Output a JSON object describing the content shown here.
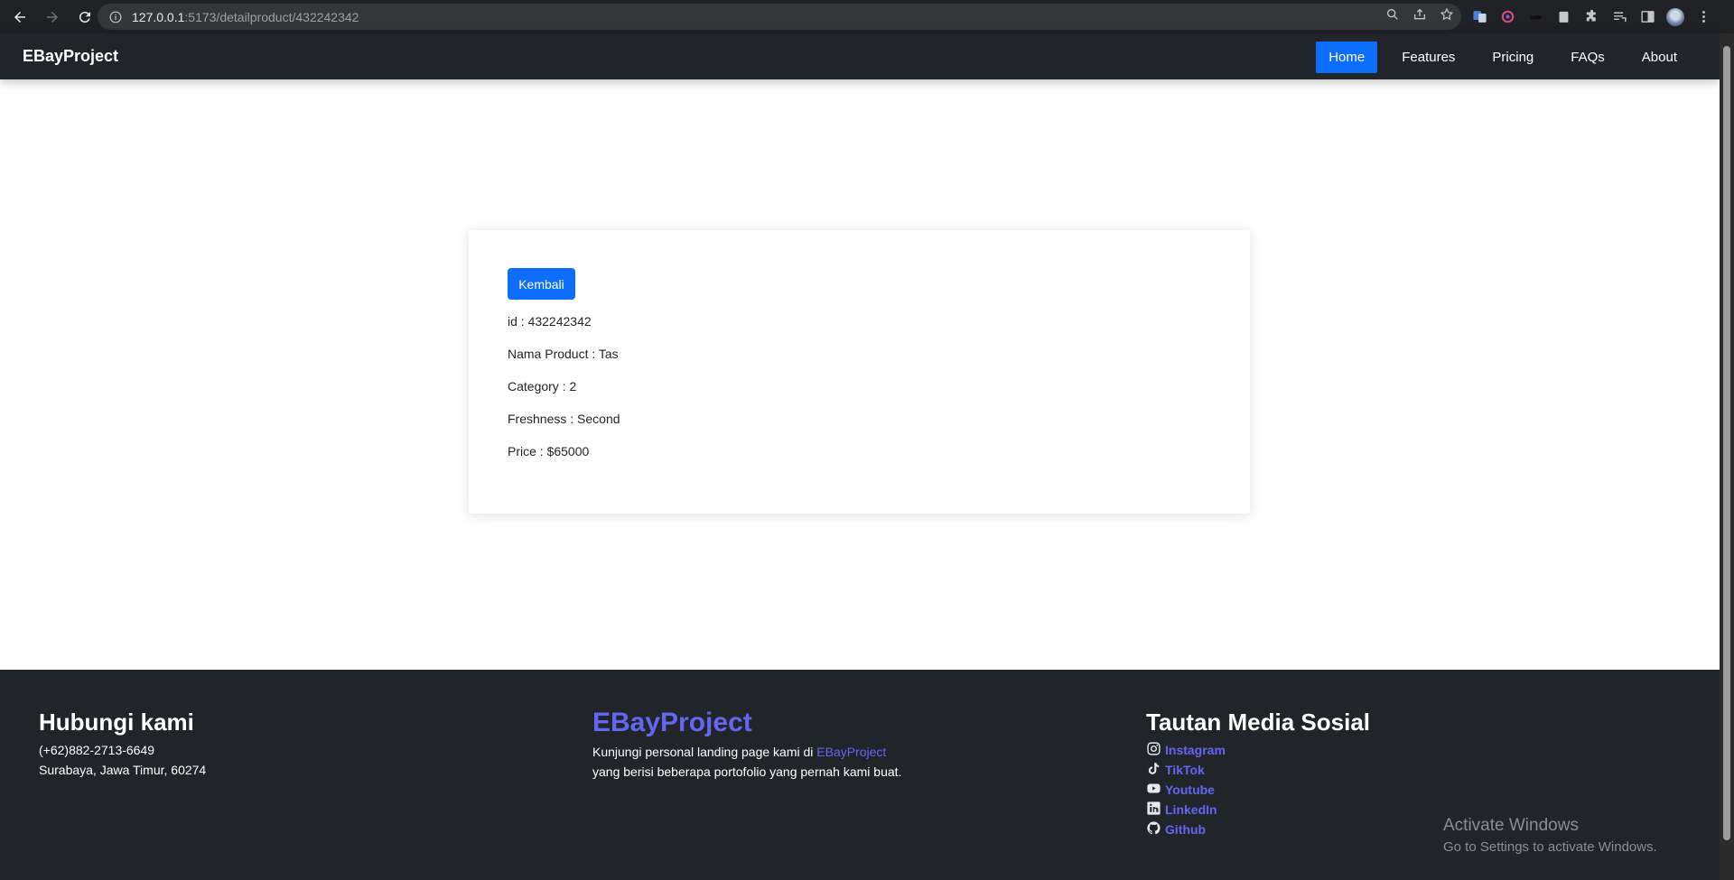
{
  "browser": {
    "url_host": "127.0.0.1",
    "url_path": ":5173/detailproduct/432242342",
    "icons": [
      "back-arrow-icon",
      "forward-arrow-icon",
      "reload-icon",
      "info-icon",
      "zoom-icon",
      "share-icon",
      "star-icon",
      "translate-icon",
      "extension-icon",
      "puzzle-icon",
      "reading-list-icon",
      "sidepanel-icon",
      "menu-icon"
    ]
  },
  "navbar": {
    "brand": "EBayProject",
    "links": [
      "Home",
      "Features",
      "Pricing",
      "FAQs",
      "About"
    ],
    "active": "Home",
    "accent_color": "#0d6efd"
  },
  "card": {
    "back_label": "Kembali",
    "details": [
      "id : 432242342",
      "Nama Product : Tas",
      "Category : 2",
      "Freshness : Second",
      "Price : $65000"
    ]
  },
  "footer": {
    "contact": {
      "title": "Hubungi kami",
      "phone": "(+62)882-2713-6649",
      "address": "Surabaya, Jawa Timur, 60274"
    },
    "about": {
      "title": "EBayProject",
      "text_before": "Kunjungi personal landing page kami di ",
      "link": "EBayProject",
      "text_after": "yang berisi beberapa portofolio yang pernah kami buat."
    },
    "social": {
      "title": "Tautan Media Sosial",
      "links": [
        "Instagram",
        "TikTok",
        "Youtube",
        "LinkedIn",
        "Github"
      ]
    },
    "accent_color": "#6366f1"
  },
  "watermark": {
    "line1": "Activate Windows",
    "line2": "Go to Settings to activate Windows."
  }
}
